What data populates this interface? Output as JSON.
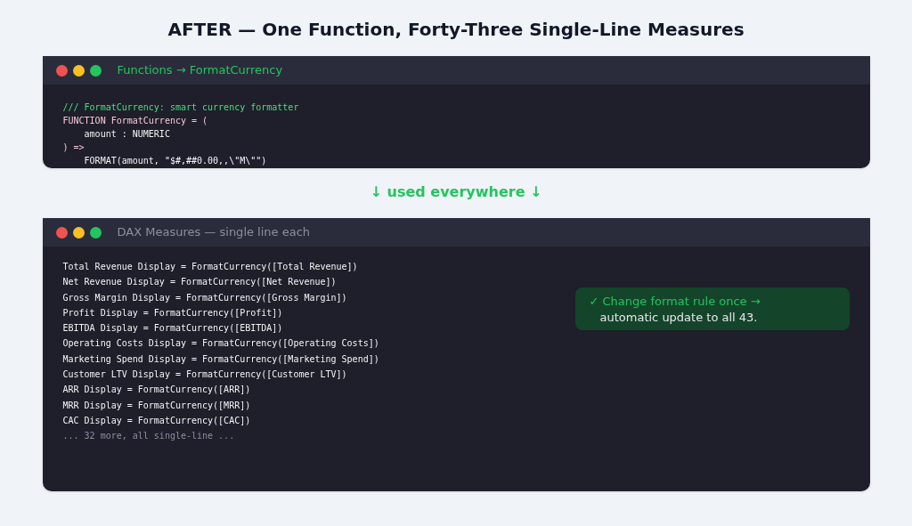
{
  "title": "AFTER — One Function, Forty-Three Single-Line Measures",
  "panels": [
    {
      "title": "Functions → FormatCurrency",
      "highlighted": true,
      "lines": [
        {
          "kind": "comment",
          "text": "/// FormatCurrency: smart currency formatter"
        },
        {
          "kind": "keyword",
          "text": "FUNCTION FormatCurrency = ("
        },
        {
          "kind": "code",
          "text": "    amount : NUMERIC"
        },
        {
          "kind": "keyword",
          "text": ") =>"
        },
        {
          "kind": "code",
          "text": "    FORMAT(amount, \"$#,##0.00,,\\\"M\\\"\")"
        }
      ]
    },
    {
      "title": "DAX Measures — single line each",
      "highlighted": false,
      "lines": [
        {
          "kind": "code",
          "text": "Total Revenue Display = FormatCurrency([Total Revenue])"
        },
        {
          "kind": "code",
          "text": "Net Revenue Display = FormatCurrency([Net Revenue])"
        },
        {
          "kind": "code",
          "text": "Gross Margin Display = FormatCurrency([Gross Margin])"
        },
        {
          "kind": "code",
          "text": "Profit Display = FormatCurrency([Profit])"
        },
        {
          "kind": "code",
          "text": "EBITDA Display = FormatCurrency([EBITDA])"
        },
        {
          "kind": "code",
          "text": "Operating Costs Display = FormatCurrency([Operating Costs])"
        },
        {
          "kind": "code",
          "text": "Marketing Spend Display = FormatCurrency([Marketing Spend])"
        },
        {
          "kind": "code",
          "text": "Customer LTV Display = FormatCurrency([Customer LTV])"
        },
        {
          "kind": "code",
          "text": "ARR Display = FormatCurrency([ARR])"
        },
        {
          "kind": "code",
          "text": "MRR Display = FormatCurrency([MRR])"
        },
        {
          "kind": "code",
          "text": "CAC Display = FormatCurrency([CAC])"
        },
        {
          "kind": "muted",
          "text": "... 32 more, all single-line ..."
        }
      ],
      "callout": {
        "headline": "✓ Change format rule once →",
        "body": "automatic update to all 43."
      }
    }
  ],
  "connector": "↓ used everywhere ↓"
}
